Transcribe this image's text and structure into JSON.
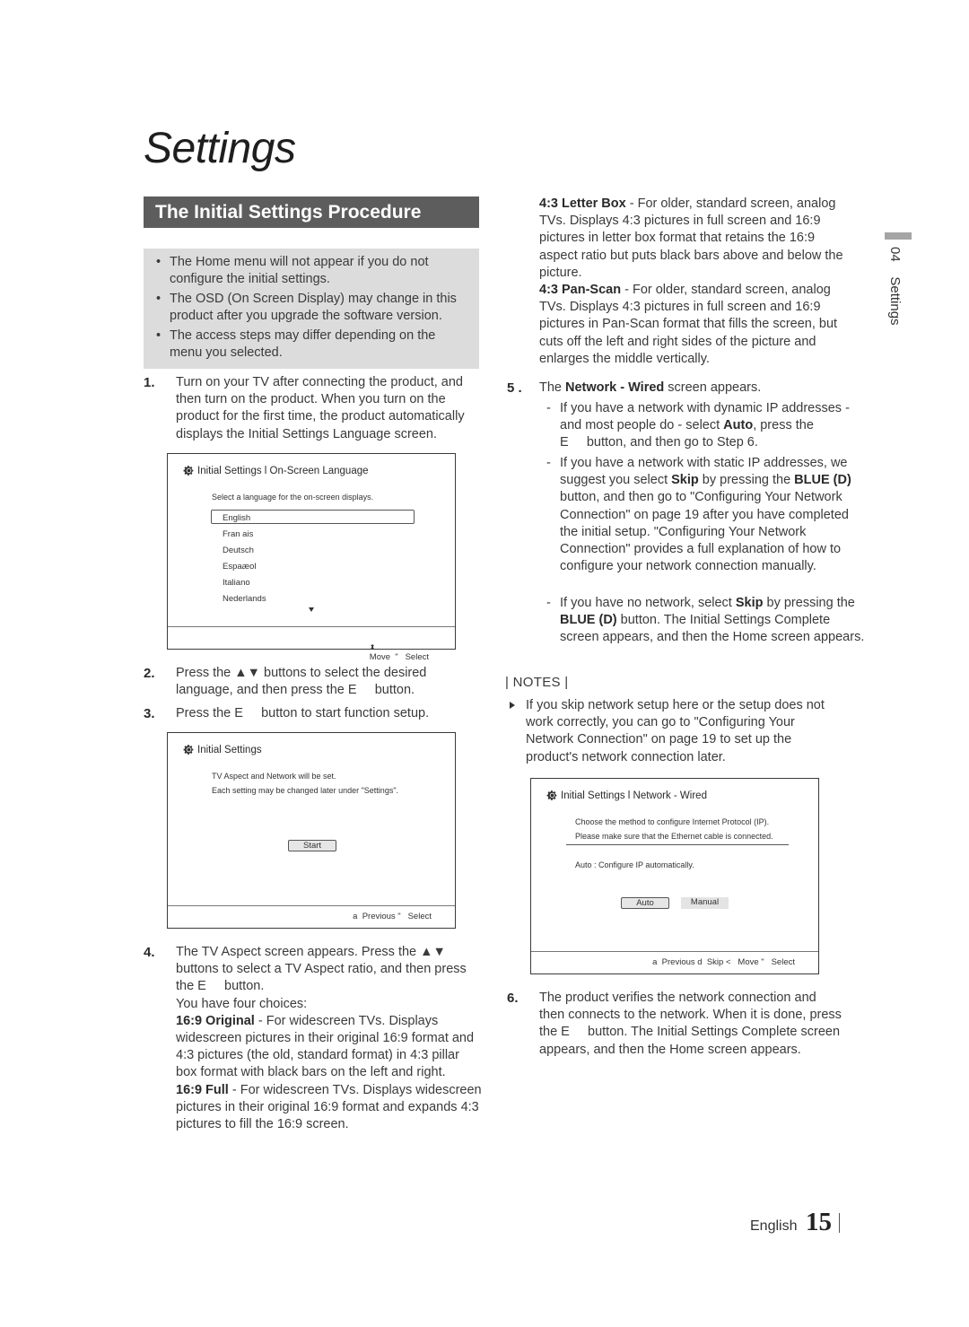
{
  "page": {
    "title": "Settings",
    "section_title": "The Initial Settings Procedure",
    "side_tab": {
      "number": "04",
      "label": "Settings"
    },
    "footer": {
      "language": "English",
      "page_number": "15"
    }
  },
  "notes_box": {
    "bullet_glyph": "•",
    "items": [
      "The Home menu will not appear if you do not configure the initial settings.",
      "The OSD (On Screen Display) may change in this product after you upgrade the software version.",
      "The access steps may differ depending on the menu you selected."
    ]
  },
  "steps": {
    "s1": {
      "num": "1.",
      "text": "Turn on your TV after connecting the product, and then turn on the product. When you turn on the product for the first time, the product automatically displays the Initial Settings Language screen."
    },
    "s2": {
      "num": "2.",
      "text_a": "Press the ▲▼ buttons to select the desired language, and then press the E",
      "text_b": "button."
    },
    "s3": {
      "num": "3.",
      "text_a": "Press the E",
      "text_b": "button to start function setup."
    },
    "s4": {
      "num": "4.",
      "text_a": "The TV Aspect screen appears. Press the ▲▼ buttons to select a TV Aspect ratio, and then press the E",
      "text_b": "button.",
      "choices_intro": "You have four choices:",
      "options": [
        {
          "name": "16:9 Original",
          "desc": " - For widescreen TVs. Displays widescreen pictures in their original 16:9 format and 4:3 pictures (the old, standard format) in 4:3 pillar box format with black bars on the left and right."
        },
        {
          "name": "16:9 Full",
          "desc": " - For widescreen TVs. Displays widescreen pictures in their original 16:9 format and expands 4:3 pictures to fill the 16:9 screen."
        },
        {
          "name": "4:3 Letter Box",
          "desc": " - For older, standard screen, analog TVs. Displays 4:3 pictures in full screen and 16:9 pictures in letter box format that retains the 16:9 aspect ratio but puts black bars above and below the picture."
        },
        {
          "name": "4:3 Pan-Scan",
          "desc": " - For older, standard screen, analog TVs. Displays 4:3 pictures in full screen and 16:9 pictures in Pan-Scan format that fills the screen, but cuts off the left and right sides of the picture and enlarges the middle vertically."
        }
      ]
    },
    "s5": {
      "num": "5 .",
      "text_pre": "The ",
      "text_bold": "Network - Wired",
      "text_post": " screen appears.",
      "dash": "-",
      "items": [
        {
          "a": "If you have a network with dynamic IP addresses - and most people do - select ",
          "b": "Auto",
          "c": ", press the E",
          "d": "button, and then go to Step 6."
        },
        {
          "a": "If you have a network with static IP addresses, we suggest you select ",
          "b": "Skip",
          "c": " by pressing the ",
          "d": "BLUE (D)",
          "e": " button, and then go to \"Configuring Your Network Connection\" on page 19 after you have completed the initial setup. \"Configuring Your Network Connection\" provides a full explanation of how to configure your network connection manually."
        },
        {
          "a": "If you have no network, select ",
          "b": "Skip",
          "c": " by pressing the ",
          "d": "BLUE (D)",
          "e": " button. The Initial Settings Complete screen appears, and then the Home screen appears."
        }
      ]
    },
    "s6": {
      "num": "6.",
      "text_a": "The product verifies the network connection and then connects to the network. When it is done, press the E",
      "text_b": "button. The Initial Settings Complete screen appears, and then the Home screen appears."
    }
  },
  "notes": {
    "heading": "| NOTES |",
    "items": [
      "If you skip network setup here or the setup does not work correctly, you can go to \"Configuring Your Network Connection\" on page 19 to set up the product's network connection later."
    ]
  },
  "osd_language": {
    "title": "Initial Settings l On-Screen Language",
    "prompt": "Select a language for the on-screen displays.",
    "languages": [
      "English",
      "Fran ais",
      "Deutsch",
      "Espaæol",
      "Italiano",
      "Nederlands"
    ],
    "selected": "English",
    "scroll_icon": "down-arrow",
    "footer": "Move  \"   Select",
    "footer_icon": "updown-arrows"
  },
  "osd_initial": {
    "title": "Initial Settings",
    "line1": "TV Aspect and Network will be set.",
    "line2": "Each setting may be changed later under \"Settings\".",
    "start_button": "Start",
    "footer": "a  Previous \"   Select"
  },
  "osd_network": {
    "title": "Initial Settings l Network - Wired",
    "line1": "Choose the method to configure Internet Protocol (IP).",
    "line2": "Please make sure that the Ethernet cable is connected.",
    "description": "Auto : Configure IP automatically.",
    "buttons": [
      "Auto",
      "Manual"
    ],
    "selected": "Auto",
    "footer": "a  Previous d  Skip <   Move \"   Select"
  }
}
